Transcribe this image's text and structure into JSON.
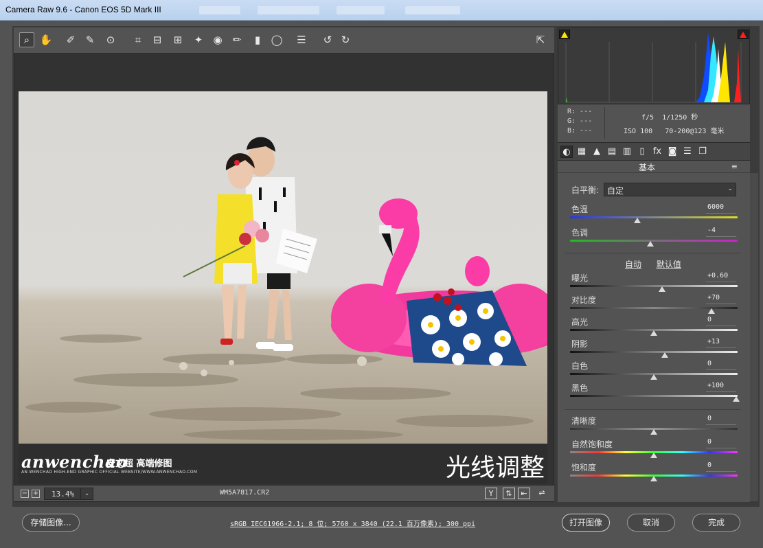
{
  "window": {
    "title": "Camera Raw 9.6 -  Canon EOS 5D Mark III"
  },
  "toolbar": {
    "tools": [
      {
        "name": "zoom-tool-icon",
        "glyph": "⌕"
      },
      {
        "name": "hand-tool-icon",
        "glyph": "✋"
      },
      {
        "name": "white-balance-tool-icon",
        "glyph": "✐"
      },
      {
        "name": "color-sampler-tool-icon",
        "glyph": "✎"
      },
      {
        "name": "targeted-adjustment-tool-icon",
        "glyph": "⊙"
      },
      {
        "name": "crop-tool-icon",
        "glyph": "⌗"
      },
      {
        "name": "straighten-tool-icon",
        "glyph": "⊟"
      },
      {
        "name": "transform-tool-icon",
        "glyph": "⊞"
      },
      {
        "name": "spot-removal-tool-icon",
        "glyph": "✦"
      },
      {
        "name": "red-eye-tool-icon",
        "glyph": "◉"
      },
      {
        "name": "adjustment-brush-icon",
        "glyph": "✏"
      },
      {
        "name": "graduated-filter-icon",
        "glyph": "▮"
      },
      {
        "name": "radial-filter-icon",
        "glyph": "◯"
      },
      {
        "name": "preferences-icon",
        "glyph": "☰"
      },
      {
        "name": "rotate-left-icon",
        "glyph": "↺"
      },
      {
        "name": "rotate-right-icon",
        "glyph": "↻"
      }
    ],
    "fullscreen_glyph": "⇱"
  },
  "branding": {
    "logo": "anwenchao",
    "logo_cn": "安文超 高端修图",
    "logo_sub": "AN WENCHAO HIGH-END GRAPHIC OFFICIAL WEBSITE/WWW.ANWENCHAO.COM",
    "headline": "光线调整"
  },
  "preview_status": {
    "zoom": "13.4%",
    "zoom_dropdown": "⌄",
    "minus": "−",
    "plus": "+",
    "filename": "WM5A7817.CR2",
    "btn_y": "Y",
    "btn_compare": "⇅",
    "btn_swap": "⇤",
    "btn_settings": "⇌"
  },
  "histogram": {
    "r": "R: ---",
    "g": "G: ---",
    "b": "B: ---"
  },
  "exif": {
    "aperture": "f/5",
    "shutter": "1/1250 秒",
    "iso": "ISO 100",
    "lens": "70-200@123 毫米"
  },
  "panel_tabs": [
    {
      "name": "tab-basic",
      "glyph": "◐"
    },
    {
      "name": "tab-tone-curve",
      "glyph": "▦"
    },
    {
      "name": "tab-detail",
      "glyph": "▲"
    },
    {
      "name": "tab-hsl",
      "glyph": "▤"
    },
    {
      "name": "tab-split-toning",
      "glyph": "▥"
    },
    {
      "name": "tab-lens",
      "glyph": "▯"
    },
    {
      "name": "tab-effects",
      "glyph": "fx"
    },
    {
      "name": "tab-camera-calibration",
      "glyph": "◙"
    },
    {
      "name": "tab-presets",
      "glyph": "☰"
    },
    {
      "name": "tab-snapshots",
      "glyph": "❐"
    }
  ],
  "panel": {
    "title": "基本",
    "menu_glyph": "≡",
    "white_balance_label": "白平衡:",
    "white_balance_value": "自定",
    "auto": "自动",
    "default": "默认值"
  },
  "sliders": [
    {
      "key": "temperature",
      "label": "色温",
      "value": "6000",
      "pos": 0.4,
      "gradient": "linear-gradient(90deg,#2233ff,#dddd22)"
    },
    {
      "key": "tint",
      "label": "色调",
      "value": "-4",
      "pos": 0.48,
      "gradient": "linear-gradient(90deg,#22bb22,#cc22cc)"
    },
    {
      "key": "exposure",
      "label": "曝光",
      "value": "+0.60",
      "pos": 0.55,
      "gradient": "linear-gradient(90deg,#111,#eee)"
    },
    {
      "key": "contrast",
      "label": "对比度",
      "value": "+70",
      "pos": 0.85,
      "gradient": "linear-gradient(90deg,#222,#888,#222)"
    },
    {
      "key": "highlights",
      "label": "高光",
      "value": "0",
      "pos": 0.5,
      "gradient": "linear-gradient(90deg,#111,#eee)"
    },
    {
      "key": "shadows",
      "label": "阴影",
      "value": "+13",
      "pos": 0.565,
      "gradient": "linear-gradient(90deg,#111,#eee)"
    },
    {
      "key": "whites",
      "label": "白色",
      "value": "0",
      "pos": 0.5,
      "gradient": "linear-gradient(90deg,#111,#eee)"
    },
    {
      "key": "blacks",
      "label": "黑色",
      "value": "+100",
      "pos": 1.0,
      "gradient": "linear-gradient(90deg,#111,#eee)"
    },
    {
      "key": "clarity",
      "label": "清晰度",
      "value": "0",
      "pos": 0.5,
      "gradient": "linear-gradient(90deg,#333,#999,#333)"
    },
    {
      "key": "vibrance",
      "label": "自然饱和度",
      "value": "0",
      "pos": 0.5,
      "gradient": "linear-gradient(90deg,#888,#f33,#ff3,#3f3,#3ff,#33f,#f3f)"
    },
    {
      "key": "saturation",
      "label": "饱和度",
      "value": "0",
      "pos": 0.5,
      "gradient": "linear-gradient(90deg,#888,#f33,#ff3,#3f3,#3ff,#33f,#f3f)"
    }
  ],
  "footer": {
    "save": "存储图像...",
    "workflow": "sRGB IEC61966-2.1; 8 位; 5760 x 3840 (22.1 百万像素); 300 ppi",
    "open": "打开图像",
    "cancel": "取消",
    "done": "完成"
  },
  "colors": {
    "accent_magenta": "#ff3aa0",
    "panel_bg": "#535353"
  }
}
